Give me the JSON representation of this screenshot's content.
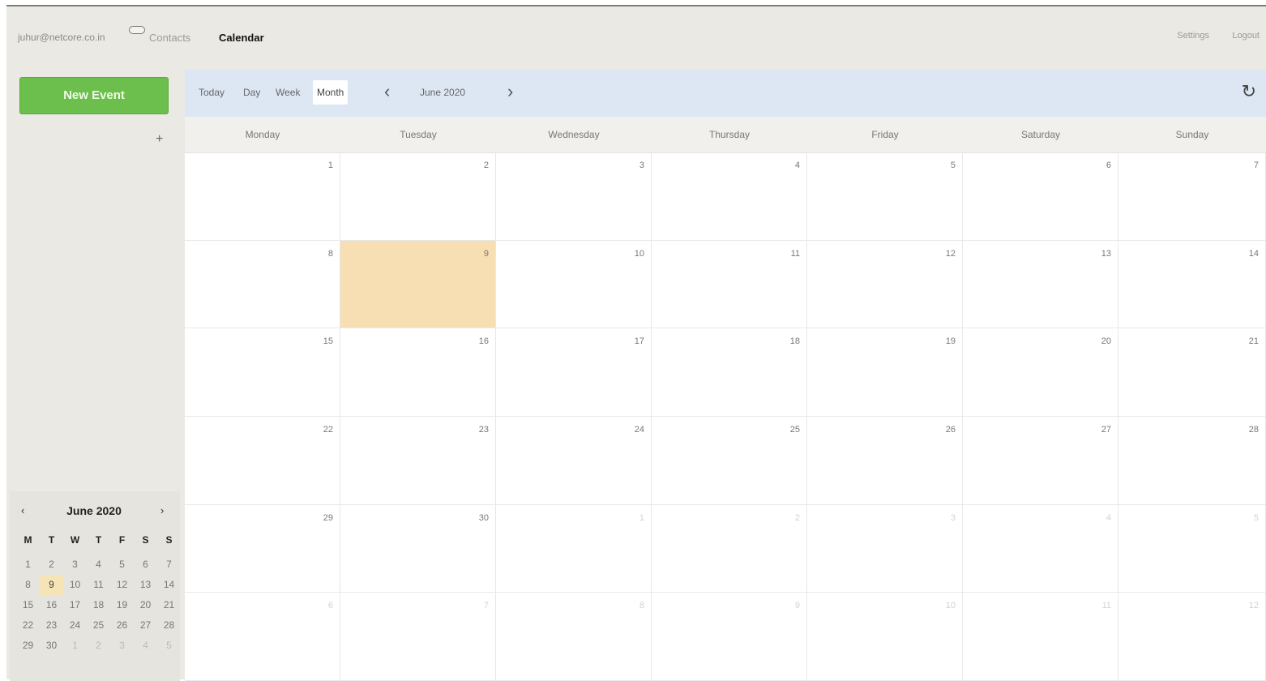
{
  "topbar": {
    "user_email": "juhur@netcore.co.in",
    "nav": {
      "contacts": "Contacts",
      "calendar": "Calendar"
    },
    "settings": "Settings",
    "logout": "Logout"
  },
  "sidebar": {
    "new_event": "New Event",
    "add_symbol": "+",
    "mini_calendar": {
      "title": "June 2020",
      "prev": "‹",
      "next": "›",
      "weekday_headers": [
        "M",
        "T",
        "W",
        "T",
        "F",
        "S",
        "S"
      ],
      "weeks": [
        [
          {
            "d": "1"
          },
          {
            "d": "2"
          },
          {
            "d": "3"
          },
          {
            "d": "4"
          },
          {
            "d": "5"
          },
          {
            "d": "6"
          },
          {
            "d": "7"
          }
        ],
        [
          {
            "d": "8"
          },
          {
            "d": "9",
            "today": true
          },
          {
            "d": "10"
          },
          {
            "d": "11"
          },
          {
            "d": "12"
          },
          {
            "d": "13"
          },
          {
            "d": "14"
          }
        ],
        [
          {
            "d": "15"
          },
          {
            "d": "16"
          },
          {
            "d": "17"
          },
          {
            "d": "18"
          },
          {
            "d": "19"
          },
          {
            "d": "20"
          },
          {
            "d": "21"
          }
        ],
        [
          {
            "d": "22"
          },
          {
            "d": "23"
          },
          {
            "d": "24"
          },
          {
            "d": "25"
          },
          {
            "d": "26"
          },
          {
            "d": "27"
          },
          {
            "d": "28"
          }
        ],
        [
          {
            "d": "29"
          },
          {
            "d": "30"
          },
          {
            "d": "1",
            "other": true
          },
          {
            "d": "2",
            "other": true
          },
          {
            "d": "3",
            "other": true
          },
          {
            "d": "4",
            "other": true
          },
          {
            "d": "5",
            "other": true
          }
        ]
      ]
    }
  },
  "toolbar": {
    "views": [
      {
        "label": "Today",
        "active": false
      },
      {
        "label": "Day",
        "active": false
      },
      {
        "label": "Week",
        "active": false
      },
      {
        "label": "Month",
        "active": true
      }
    ],
    "prev": "‹",
    "next": "›",
    "title": "June 2020",
    "refresh_icon": "↻"
  },
  "calendar": {
    "weekdays": [
      "Monday",
      "Tuesday",
      "Wednesday",
      "Thursday",
      "Friday",
      "Saturday",
      "Sunday"
    ],
    "weeks": [
      [
        {
          "d": "1"
        },
        {
          "d": "2"
        },
        {
          "d": "3"
        },
        {
          "d": "4"
        },
        {
          "d": "5"
        },
        {
          "d": "6"
        },
        {
          "d": "7"
        }
      ],
      [
        {
          "d": "8"
        },
        {
          "d": "9",
          "today": true
        },
        {
          "d": "10"
        },
        {
          "d": "11"
        },
        {
          "d": "12"
        },
        {
          "d": "13"
        },
        {
          "d": "14"
        }
      ],
      [
        {
          "d": "15"
        },
        {
          "d": "16"
        },
        {
          "d": "17"
        },
        {
          "d": "18"
        },
        {
          "d": "19"
        },
        {
          "d": "20"
        },
        {
          "d": "21"
        }
      ],
      [
        {
          "d": "22"
        },
        {
          "d": "23"
        },
        {
          "d": "24"
        },
        {
          "d": "25"
        },
        {
          "d": "26"
        },
        {
          "d": "27"
        },
        {
          "d": "28"
        }
      ],
      [
        {
          "d": "29"
        },
        {
          "d": "30"
        },
        {
          "d": "1",
          "other": true
        },
        {
          "d": "2",
          "other": true
        },
        {
          "d": "3",
          "other": true
        },
        {
          "d": "4",
          "other": true
        },
        {
          "d": "5",
          "other": true
        }
      ],
      [
        {
          "d": "6",
          "other": true
        },
        {
          "d": "7",
          "other": true
        },
        {
          "d": "8",
          "other": true
        },
        {
          "d": "9",
          "other": true
        },
        {
          "d": "10",
          "other": true
        },
        {
          "d": "11",
          "other": true
        },
        {
          "d": "12",
          "other": true
        }
      ]
    ]
  }
}
